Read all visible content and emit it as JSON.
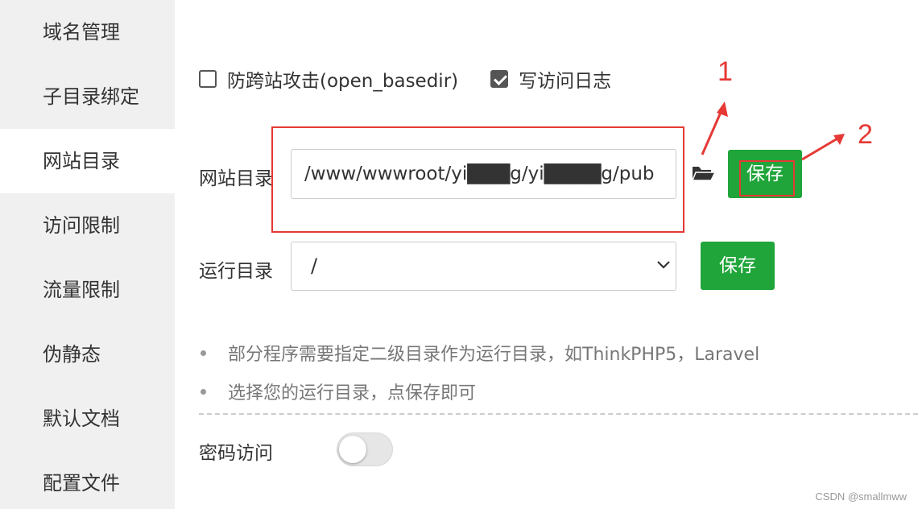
{
  "sidebar": {
    "items": [
      {
        "label": "域名管理",
        "active": false
      },
      {
        "label": "子目录绑定",
        "active": false
      },
      {
        "label": "网站目录",
        "active": true
      },
      {
        "label": "访问限制",
        "active": false
      },
      {
        "label": "流量限制",
        "active": false
      },
      {
        "label": "伪静态",
        "active": false
      },
      {
        "label": "默认文档",
        "active": false
      },
      {
        "label": "配置文件",
        "active": false
      }
    ]
  },
  "options": {
    "anti_xss": {
      "label": "防跨站攻击(open_basedir)",
      "checked": false
    },
    "access_log": {
      "label": "写访问日志",
      "checked": true
    }
  },
  "site_dir": {
    "label": "网站目录",
    "value": "/www/wwwroot/yi███g/yi████g/pub",
    "save_label": "保存",
    "folder_icon": "folder-open-icon"
  },
  "run_dir": {
    "label": "运行目录",
    "selected": "/",
    "save_label": "保存"
  },
  "hints": [
    "部分程序需要指定二级目录作为运行目录，如ThinkPHP5，Laravel",
    "选择您的运行目录，点保存即可"
  ],
  "password_access": {
    "label": "密码访问",
    "enabled": false
  },
  "annotations": {
    "marker_1": "1",
    "marker_2": "2"
  },
  "watermark": "CSDN @smallmww",
  "colors": {
    "accent_green": "#20a53a",
    "annotation_red": "#e53935",
    "sidebar_bg": "#f0f0f0"
  }
}
